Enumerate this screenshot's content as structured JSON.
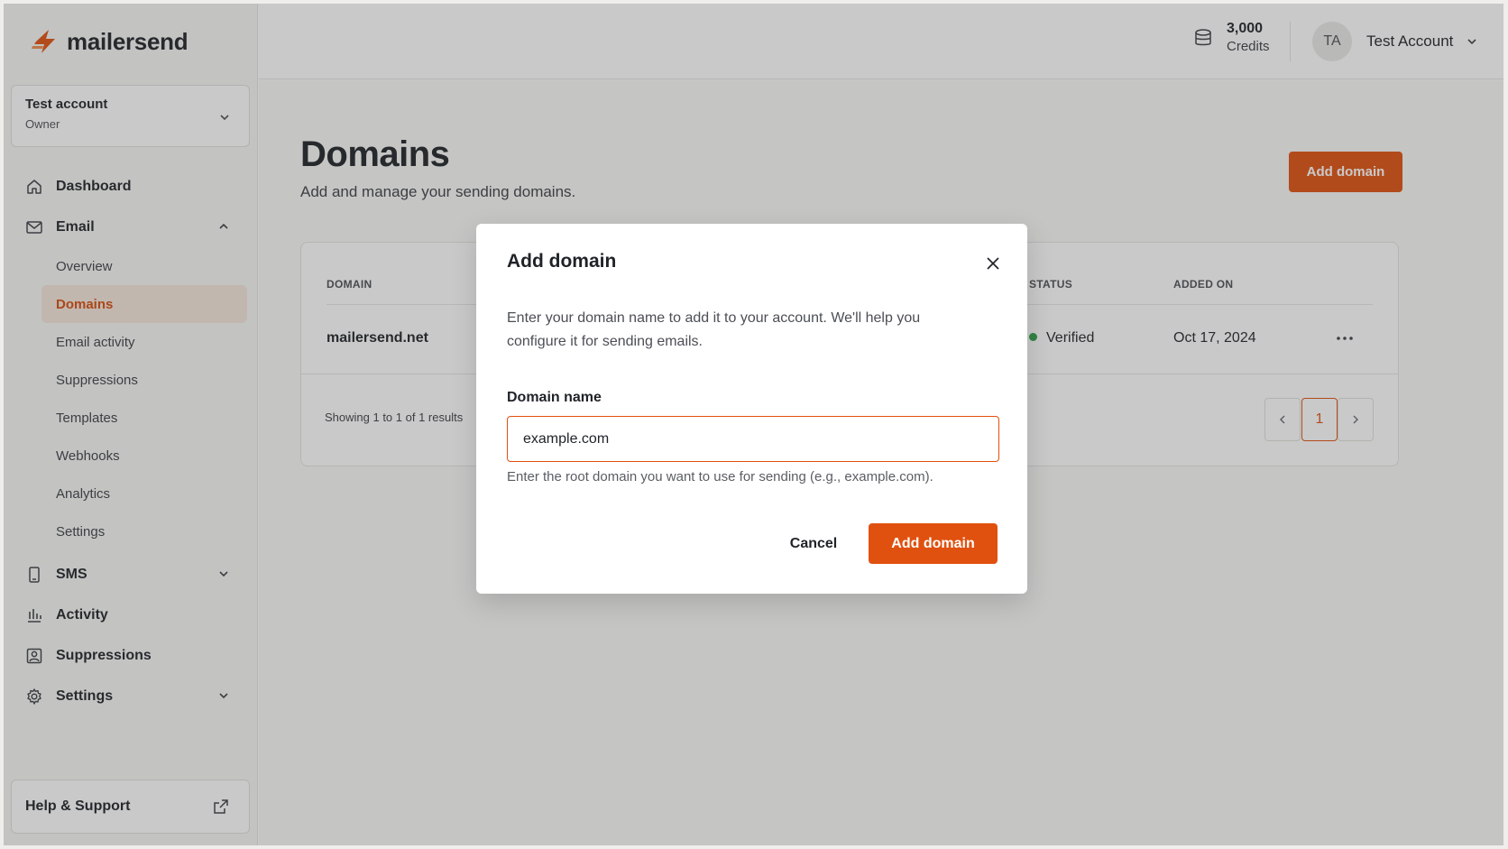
{
  "app": {
    "name": "mailersend",
    "brand_color": "#e0510f"
  },
  "account": {
    "name": "Test account",
    "role": "Owner"
  },
  "sidebar": {
    "items": [
      {
        "label": "Dashboard",
        "icon": "home-icon"
      },
      {
        "label": "Email",
        "icon": "mail-icon",
        "expanded": true,
        "children": [
          "Overview",
          "Domains",
          "Email activity",
          "Suppressions",
          "Templates",
          "Webhooks",
          "Analytics",
          "Settings"
        ],
        "active_child": "Domains"
      },
      {
        "label": "SMS",
        "icon": "phone-icon"
      },
      {
        "label": "Activity",
        "icon": "bar-chart-icon"
      },
      {
        "label": "Suppressions",
        "icon": "user-block-icon"
      },
      {
        "label": "Settings",
        "icon": "gear-icon"
      }
    ],
    "help": {
      "label": "Help & Support",
      "icon": "external-link-icon"
    }
  },
  "topbar": {
    "credits_value": "3,000",
    "credits_label": "Credits",
    "user_initials": "TA",
    "user_name": "Test Account"
  },
  "page": {
    "title": "Domains",
    "subtitle": "Add and manage your sending domains.",
    "add_button": "Add domain"
  },
  "table": {
    "columns": [
      "DOMAIN",
      "STATUS",
      "ADDED ON"
    ],
    "rows": [
      {
        "domain": "mailersend.net",
        "status": "Verified",
        "added_on": "Oct 17, 2024"
      }
    ],
    "showing": "Showing 1 to 1 of 1 results",
    "current_page": "1",
    "status_color": "#2e9e47"
  },
  "modal": {
    "title": "Add domain",
    "description": "Enter your domain name to add it to your account. We'll help you configure it for sending emails.",
    "field_label": "Domain name",
    "field_value": "example.com",
    "hint": "Enter the root domain you want to use for sending (e.g., example.com).",
    "cancel_label": "Cancel",
    "submit_label": "Add domain"
  }
}
